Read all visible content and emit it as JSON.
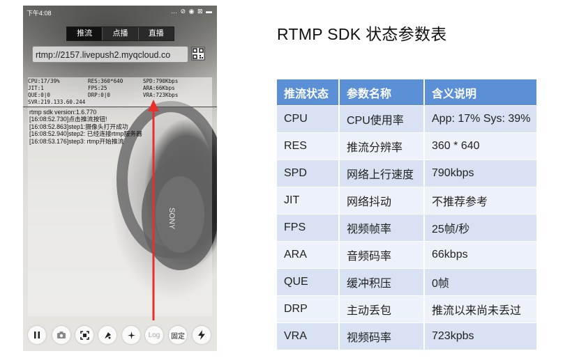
{
  "phone": {
    "status_time": "下午4:08",
    "status_icons": "… ⊘ ◉ ⊠ ▬",
    "tabs": [
      {
        "label": "推流"
      },
      {
        "label": "点播"
      },
      {
        "label": "直播"
      }
    ],
    "url_value": "rtmp://2157.livepush2.myqcloud.co",
    "stats": {
      "cpu": "CPU:17/39%",
      "res": "RES:360*640",
      "spd": "SPD:790Kbps",
      "jit": "JIT:1",
      "fps": "FPS:25",
      "ara": "ARA:66Kbps",
      "que": "QUE:0|0",
      "drp": "DRP:0|0",
      "vra": "VRA:723Kbps",
      "svr": "SVR:219.133.60.244"
    },
    "log_lines": [
      "rtmp sdk version:1.6.770",
      "[16:08:52.730]点击推流按钮!",
      "[16:08:52.863]step1:摄像头打开成功",
      "[16:08:52.940]step2: 已经连接rtmp服务器",
      "[16:08:53.176]step3: rtmp开始推流"
    ],
    "toolbar": {
      "log_label": "Log",
      "fix_label": "固定"
    },
    "brand_text": "SONY"
  },
  "table": {
    "title": "RTMP SDK 状态参数表",
    "headers": [
      "推流状态",
      "参数名称",
      "含义说明"
    ],
    "rows": [
      [
        "CPU",
        "CPU使用率",
        "App: 17% Sys: 39%"
      ],
      [
        "RES",
        "推流分辨率",
        "360 * 640"
      ],
      [
        "SPD",
        "网络上行速度",
        "790kbps"
      ],
      [
        "JIT",
        "网络抖动",
        "不推荐参考"
      ],
      [
        "FPS",
        "视频帧率",
        "25帧/秒"
      ],
      [
        "ARA",
        "音频码率",
        "66kbps"
      ],
      [
        "QUE",
        "缓冲积压",
        "0帧"
      ],
      [
        "DRP",
        "主动丢包",
        "推流以来尚未丢过"
      ],
      [
        "VRA",
        "视频码率",
        "723kpbs"
      ]
    ]
  },
  "colors": {
    "header_bg": "#5b8fd6",
    "row_odd": "#d9e2f3",
    "row_even": "#edf1f9",
    "annotation_arrow": "#e8302a"
  }
}
